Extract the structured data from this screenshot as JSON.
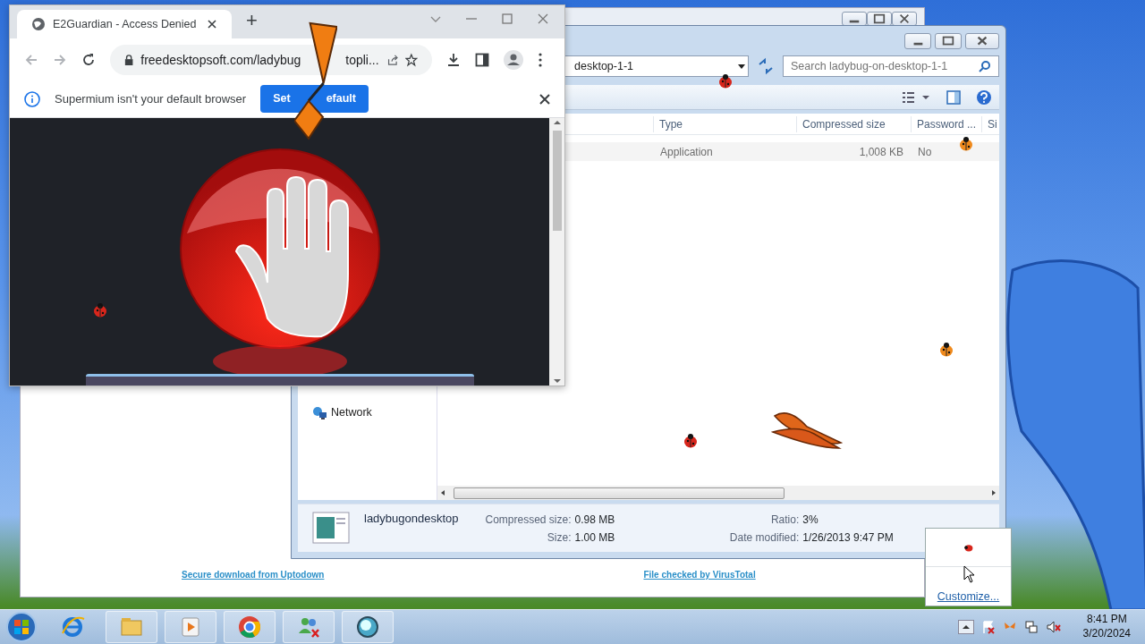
{
  "browser": {
    "tab": {
      "title": "E2Guardian - Access Denied",
      "selected": true
    },
    "new_tab": "+",
    "url_parts": [
      "freedesktopsoft.com/ladybug",
      "topli..."
    ],
    "infobar": {
      "message": "Supermium isn't your default browser",
      "button_parts": [
        "Set",
        "efault"
      ]
    }
  },
  "explorer": {
    "address": "desktop-1-1",
    "search": {
      "placeholder": "Search ladybug-on-desktop-1-1"
    },
    "nav_items": [
      "Network"
    ],
    "columns": [
      "Type",
      "Compressed size",
      "Password ...",
      "Si"
    ],
    "rows": [
      {
        "cells": [
          "Application",
          "1,008 KB",
          "No"
        ]
      }
    ],
    "details": {
      "name": "ladybugondesktop",
      "fields": [
        {
          "label": "Compressed size:",
          "value": "0.98 MB"
        },
        {
          "label": "Size:",
          "value": "1.00 MB"
        },
        {
          "label": "Ratio:",
          "value": "3%"
        },
        {
          "label": "Date modified:",
          "value": "1/26/2013 9:47 PM"
        }
      ]
    }
  },
  "background_page": {
    "links": [
      "Secure download from Uptodown",
      "File checked by VirusTotal"
    ]
  },
  "tray_popup": {
    "link": "Customize..."
  },
  "taskbar": {
    "time": "8:41 PM",
    "date": "3/20/2024"
  }
}
